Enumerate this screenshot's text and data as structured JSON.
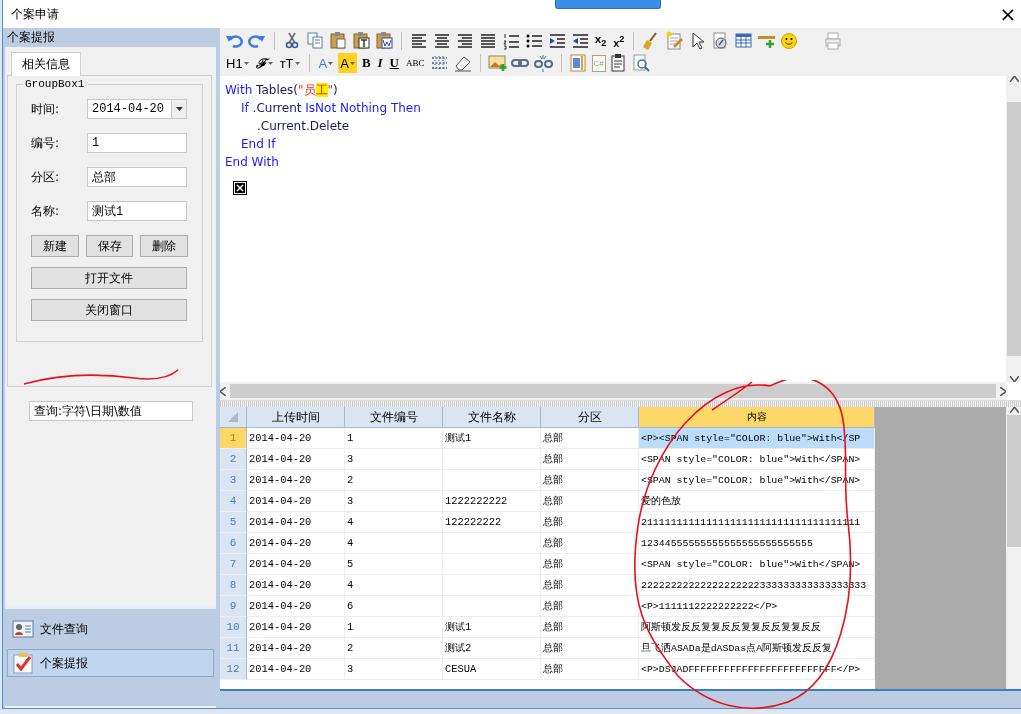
{
  "window": {
    "title": "个案申请",
    "close": "×"
  },
  "left_panel": {
    "header": "个案提报",
    "tabs": [
      {
        "label": "相关信息",
        "selected": true
      }
    ],
    "groupbox": {
      "title": "GroupBox1",
      "fields": [
        {
          "kind": "date",
          "label": "时间:",
          "value": "2014-04-20"
        },
        {
          "kind": "text",
          "label": "编号:",
          "value": "1"
        },
        {
          "kind": "text",
          "label": "分区:",
          "value": "总部"
        },
        {
          "kind": "text",
          "label": "名称:",
          "value": "测试1"
        }
      ],
      "buttons": [
        "新建",
        "保存",
        "删除"
      ],
      "wide_buttons": [
        "打开文件",
        "关闭窗口"
      ]
    },
    "query": {
      "value": "查询:字符\\日期\\数值"
    },
    "nav": [
      {
        "label": "文件查询",
        "kind": "people",
        "selected": false
      },
      {
        "label": "个案提报",
        "kind": "check",
        "selected": true
      }
    ]
  },
  "toolbar": {
    "labels": [
      "x$_{2}$",
      "x$^{2}$",
      "H1",
      "ℱ",
      "тT",
      "A",
      "A",
      "B",
      "I",
      "U",
      "ABC",
      "C#"
    ]
  },
  "editor": {
    "lines": [
      {
        "segments": [
          {
            "t": "With",
            "kind": "keyword"
          },
          {
            "t": " Tables(",
            "kind": "plain"
          },
          {
            "t": "\"员",
            "kind": "string"
          },
          {
            "t": "工",
            "kind": "marked"
          },
          {
            "t": "\"",
            "kind": "string"
          },
          {
            "t": ")",
            "kind": "plain"
          }
        ],
        "children": [
          {
            "segments": [
              {
                "t": "If",
                "kind": "keyword"
              },
              {
                "t": " .Current ",
                "kind": "plain"
              },
              {
                "t": "IsNot Nothing Then",
                "kind": "keyword"
              }
            ],
            "children": [
              {
                "segments": [
                  {
                    "t": ".Current.Delete",
                    "kind": "plain"
                  }
                ]
              }
            ]
          },
          {
            "segments": [
              {
                "t": "End If",
                "kind": "keyword"
              }
            ]
          }
        ]
      },
      {
        "segments": [
          {
            "t": "End With",
            "kind": "keyword"
          }
        ]
      }
    ]
  },
  "grid": {
    "columns": [
      {
        "label": "上传时间",
        "selected": false
      },
      {
        "label": "文件编号",
        "selected": false
      },
      {
        "label": "文件名称",
        "selected": false
      },
      {
        "label": "分区",
        "selected": false
      },
      {
        "label": "内容",
        "selected": true
      }
    ],
    "rows": [
      {
        "n": "1",
        "cells": [
          "2014-04-20",
          "1",
          "测试1",
          "总部",
          "<P><SPAN  style=\"COLOR: blue\">With</SP"
        ],
        "selected": true
      },
      {
        "n": "2",
        "cells": [
          "2014-04-20",
          "3",
          "",
          "总部",
          "<SPAN  style=\"COLOR: blue\">With</SPAN>"
        ],
        "selected": false
      },
      {
        "n": "3",
        "cells": [
          "2014-04-20",
          "2",
          "",
          "总部",
          "<SPAN  style=\"COLOR: blue\">With</SPAN>"
        ],
        "selected": false
      },
      {
        "n": "4",
        "cells": [
          "2014-04-20",
          "3",
          "1222222222",
          "总部",
          "爱的色放"
        ],
        "selected": false
      },
      {
        "n": "5",
        "cells": [
          "2014-04-20",
          "4",
          "122222222",
          "总部",
          "2111111111111111111111111111111111111"
        ],
        "selected": false
      },
      {
        "n": "6",
        "cells": [
          "2014-04-20",
          "4",
          "",
          "总部",
          "12344555555555555555555555555"
        ],
        "selected": false
      },
      {
        "n": "7",
        "cells": [
          "2014-04-20",
          "5",
          "",
          "总部",
          "<SPAN  style=\"COLOR: blue\">With</SPAN>"
        ],
        "selected": false
      },
      {
        "n": "8",
        "cells": [
          "2014-04-20",
          "4",
          "",
          "总部",
          "22222222222222222222333333333333333333"
        ],
        "selected": false
      },
      {
        "n": "9",
        "cells": [
          "2014-04-20",
          "6",
          "",
          "总部",
          "<P>1111112222222222</P>"
        ],
        "selected": false
      },
      {
        "n": "10",
        "cells": [
          "2014-04-20",
          "1",
          "测试1",
          "总部",
          "阿斯顿发反反复复反反复复反反复复反反"
        ],
        "selected": false
      },
      {
        "n": "11",
        "cells": [
          "2014-04-20",
          "2",
          "测试2",
          "总部",
          "旦飞洒ASADa是dASDas点A阿斯顿发反反复"
        ],
        "selected": false
      },
      {
        "n": "12",
        "cells": [
          "2014-04-20",
          "3",
          "CESUA",
          "总部",
          "<P>DSJADFFFFFFFFFFFFFFFFFFFFFFFFF</P>"
        ],
        "selected": false
      }
    ]
  }
}
